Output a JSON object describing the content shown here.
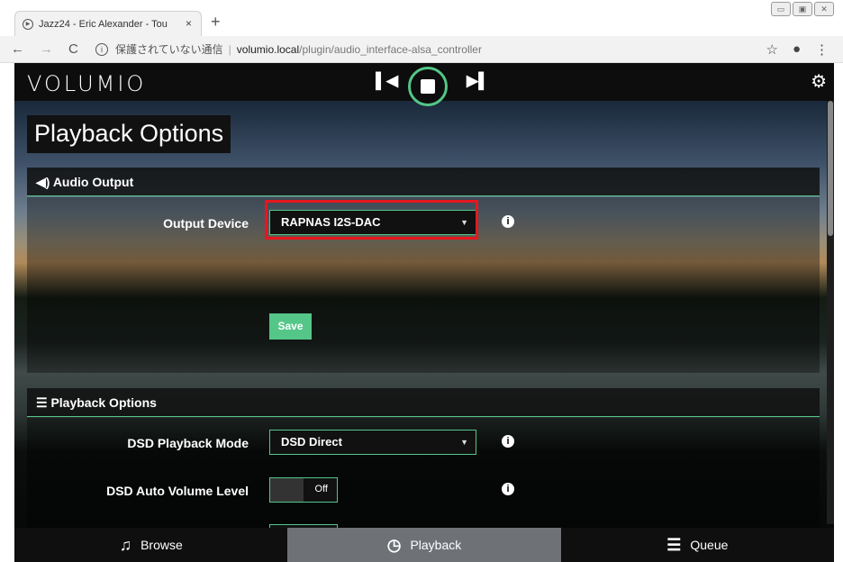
{
  "browser": {
    "tab_title": "Jazz24 - Eric Alexander - Tou",
    "tab_close": "×",
    "new_tab": "+",
    "security_text": "保護されていない通信",
    "url_host": "volumio.local",
    "url_path": "/plugin/audio_interface-alsa_controller"
  },
  "app": {
    "logo": "VOLUMIO",
    "page_title": "Playback Options",
    "sections": {
      "audio_output": "Audio Output",
      "playback_options": "Playback Options"
    },
    "output_device": {
      "label": "Output Device",
      "value": "RAPNAS I2S-DAC"
    },
    "save_label": "Save",
    "dsd_mode": {
      "label": "DSD Playback Mode",
      "value": "DSD Direct"
    },
    "dsd_auto_volume": {
      "label": "DSD Auto Volume Level",
      "value": "Off"
    },
    "bottom_nav": {
      "browse": "Browse",
      "playback": "Playback",
      "queue": "Queue"
    }
  },
  "colors": {
    "accent": "#54c688",
    "highlight": "#e8161e"
  }
}
